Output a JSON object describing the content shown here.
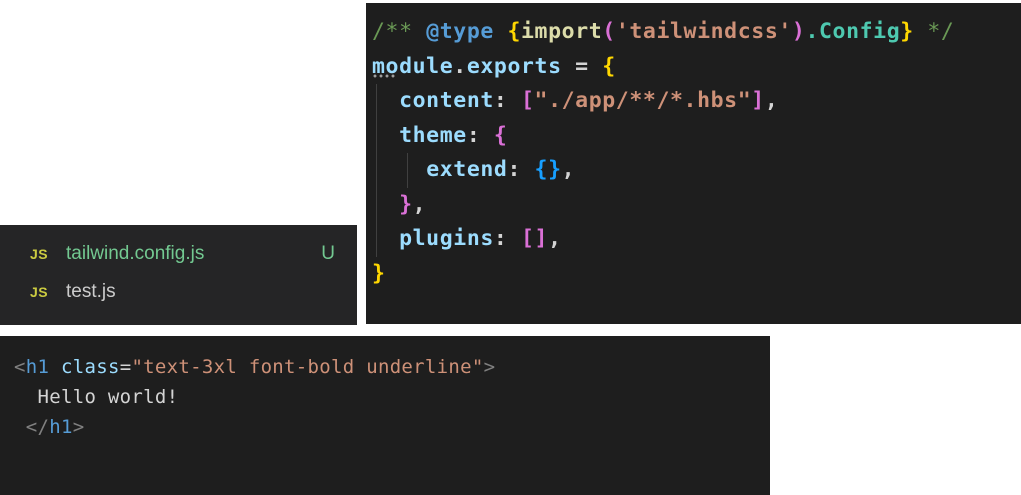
{
  "explorer": {
    "files": [
      {
        "icon": "JS",
        "name": "tailwind.config.js",
        "git_status": "U"
      },
      {
        "icon": "JS",
        "name": "test.js"
      }
    ]
  },
  "config_code": {
    "l1_comment_open": "/** ",
    "l1_tag": "@type",
    "l1_space": " ",
    "l1_brace_open": "{",
    "l1_func": "import",
    "l1_paren_open": "(",
    "l1_string": "'tailwindcss'",
    "l1_paren_close": ")",
    "l1_dot_config": ".Config",
    "l1_brace_close": "}",
    "l1_comment_close": " */",
    "l2_module": "module",
    "l2_dot": ".",
    "l2_exports": "exports",
    "l2_eq": " = ",
    "l2_brace": "{",
    "l3_key": "content",
    "l3_colon": ": ",
    "l3_bracket_open": "[",
    "l3_string": "\"./app/**/*.hbs\"",
    "l3_bracket_close": "]",
    "l3_comma": ",",
    "l4_key": "theme",
    "l4_colon": ": ",
    "l4_brace": "{",
    "l5_key": "extend",
    "l5_colon": ": ",
    "l5_braces": "{}",
    "l5_comma": ",",
    "l6_brace": "}",
    "l6_comma": ",",
    "l7_key": "plugins",
    "l7_colon": ": ",
    "l7_brackets": "[]",
    "l7_comma": ",",
    "l8_brace": "}"
  },
  "html_code": {
    "open_lt": "<",
    "open_tag": "h1",
    "space": " ",
    "attr_name": "class",
    "eq": "=",
    "attr_value": "\"text-3xl font-bold underline\"",
    "open_gt": ">",
    "content": "Hello world!",
    "close_lt": "</",
    "close_tag": "h1",
    "close_gt": ">"
  }
}
